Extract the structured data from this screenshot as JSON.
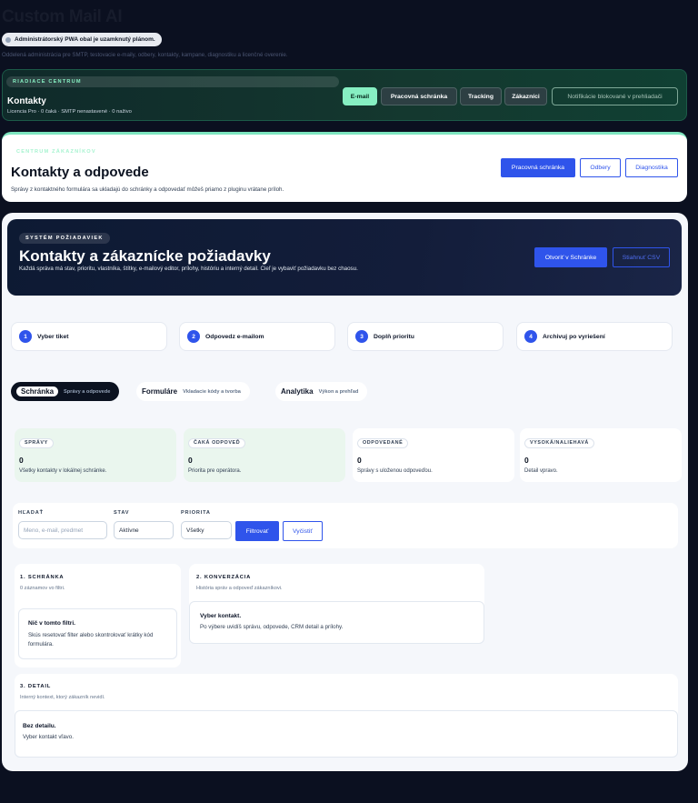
{
  "app": {
    "title": "Custom Mail AI",
    "pwa_notice": "Administrátorský PWA obal je uzamknutý plánom.",
    "subtitle": "Oddelená administrácia pre SMTP, testovacie e-maily, odbery, kontakty, kampane, diagnostiku a licenčné overenie."
  },
  "control_center": {
    "kicker": "RIADIACE CENTRUM",
    "title": "Kontakty",
    "meta": "Licencia Pro · 0 čaká · SMTP nenastavené · 0 naživo",
    "buttons": [
      "E-mail",
      "Pracovná schránka",
      "Tracking",
      "Zákazníci"
    ],
    "notifications": "Notifikácie blokované v prehliadači"
  },
  "customer_center": {
    "kicker": "CENTRUM ZÁKAZNÍKOV",
    "title": "Kontakty a odpovede",
    "description": "Správy z kontaktného formulára sa ukladajú do schránky a odpovedať môžeš priamo z pluginu vrátane príloh.",
    "btn_inbox": "Pracovná schránka",
    "btn_subscriptions": "Odbery",
    "btn_diagnostics": "Diagnostika"
  },
  "hero": {
    "kicker": "SYSTÉM POŽIADAVIEK",
    "title": "Kontakty a zákaznícke požiadavky",
    "description": "Každá správa má stav, prioritu, vlastníka, štítky, e-mailový editor, prílohy, históriu a interný detail. Cieľ je vybaviť požiadavku bez chaosu.",
    "btn_open": "Otvoriť v Schránke",
    "btn_csv": "Stiahnuť CSV"
  },
  "steps": [
    {
      "num": "1",
      "label": "Vyber tiket"
    },
    {
      "num": "2",
      "label": "Odpovedz e-mailom"
    },
    {
      "num": "3",
      "label": "Doplň prioritu"
    },
    {
      "num": "4",
      "label": "Archivuj po vyriešení"
    }
  ],
  "tabs": [
    {
      "label": "Schránka",
      "sub": "Správy a odpovede"
    },
    {
      "label": "Formuláre",
      "sub": "Vkladacie kódy a tvorba"
    },
    {
      "label": "Analytika",
      "sub": "Výkon a prehľad"
    }
  ],
  "stats": [
    {
      "badge": "SPRÁVY",
      "value": "0",
      "note": "Všetky kontakty v lokálnej schránke."
    },
    {
      "badge": "ČAKÁ ODPOVEĎ",
      "value": "0",
      "note": "Priorita pre operátora."
    },
    {
      "badge": "ODPOVEDANÉ",
      "value": "0",
      "note": "Správy s uloženou odpoveďou."
    },
    {
      "badge": "VYSOKÁ/NALIEHAVÁ",
      "value": "0",
      "note": "Detail vpravo."
    }
  ],
  "filters": {
    "search_label": "HĽADAŤ",
    "search_placeholder": "Meno, e-mail, predmet",
    "status_label": "STAV",
    "status_value": "Aktívne",
    "priority_label": "PRIORITA",
    "priority_value": "Všetky",
    "filter_btn": "Filtrovať",
    "clear_btn": "Vyčistiť"
  },
  "inbox": {
    "title": "1. SCHRÁNKA",
    "sub": "0 záznamov vo filtri.",
    "empty_title": "Nič v tomto filtri.",
    "empty_text": "Skús resetovať filter alebo skontrolovať krátky kód formulára."
  },
  "conversation": {
    "title": "2. KONVERZÁCIA",
    "sub": "História správ a odpoveď zákazníkovi.",
    "empty_title": "Vyber kontakt.",
    "empty_text": "Po výbere uvidíš správu, odpovede, CRM detail a prílohy."
  },
  "detail": {
    "title": "3. DETAIL",
    "sub": "Interný kontext, ktorý zákazník nevidí.",
    "empty_title": "Bez detailu.",
    "empty_text": "Vyber kontakt vľavo."
  }
}
